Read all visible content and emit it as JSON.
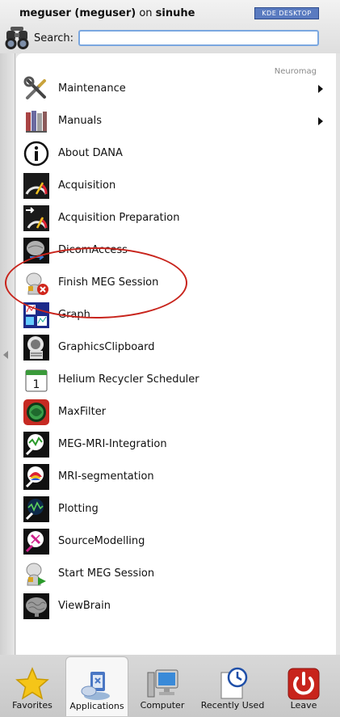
{
  "header": {
    "user_prefix": "meguser (meguser)",
    "user_on": "on",
    "host": "sinuhe",
    "badge": "KDE DESKTOP"
  },
  "search": {
    "label": "Search:",
    "value": "",
    "placeholder": ""
  },
  "section": {
    "label": "Neuromag"
  },
  "items": [
    {
      "label": "Maintenance",
      "icon": "tools-icon",
      "submenu": true
    },
    {
      "label": "Manuals",
      "icon": "books-icon",
      "submenu": true
    },
    {
      "label": "About DANA",
      "icon": "info-icon",
      "submenu": false
    },
    {
      "label": "Acquisition",
      "icon": "gauge-icon",
      "submenu": false
    },
    {
      "label": "Acquisition Preparation",
      "icon": "gauge-prep-icon",
      "submenu": false
    },
    {
      "label": "DicomAccess",
      "icon": "dicom-brain-icon",
      "submenu": false
    },
    {
      "label": "Finish MEG Session",
      "icon": "finish-session-icon",
      "submenu": false
    },
    {
      "label": "Graph",
      "icon": "graph-icon",
      "submenu": false
    },
    {
      "label": "GraphicsClipboard",
      "icon": "graphics-clipboard-icon",
      "submenu": false
    },
    {
      "label": "Helium Recycler Scheduler",
      "icon": "calendar-icon",
      "submenu": false
    },
    {
      "label": "MaxFilter",
      "icon": "maxfilter-icon",
      "submenu": false
    },
    {
      "label": "MEG-MRI-Integration",
      "icon": "meg-mri-icon",
      "submenu": false
    },
    {
      "label": "MRI-segmentation",
      "icon": "mri-segmentation-icon",
      "submenu": false
    },
    {
      "label": "Plotting",
      "icon": "plotting-icon",
      "submenu": false
    },
    {
      "label": "SourceModelling",
      "icon": "source-modelling-icon",
      "submenu": false
    },
    {
      "label": "Start MEG Session",
      "icon": "start-session-icon",
      "submenu": false
    },
    {
      "label": "ViewBrain",
      "icon": "brain-icon",
      "submenu": false
    }
  ],
  "tabs": [
    {
      "label": "Favorites",
      "icon": "star-icon",
      "active": false
    },
    {
      "label": "Applications",
      "icon": "applications-icon",
      "active": true
    },
    {
      "label": "Computer",
      "icon": "computer-icon",
      "active": false
    },
    {
      "label": "Recently Used",
      "icon": "clock-document-icon",
      "active": false
    },
    {
      "label": "Leave",
      "icon": "power-icon",
      "active": false
    }
  ],
  "colors": {
    "annotation": "#c8241c",
    "search_border": "#7aa7e0",
    "leave_red": "#c8241c",
    "star_yellow": "#f5c518"
  }
}
